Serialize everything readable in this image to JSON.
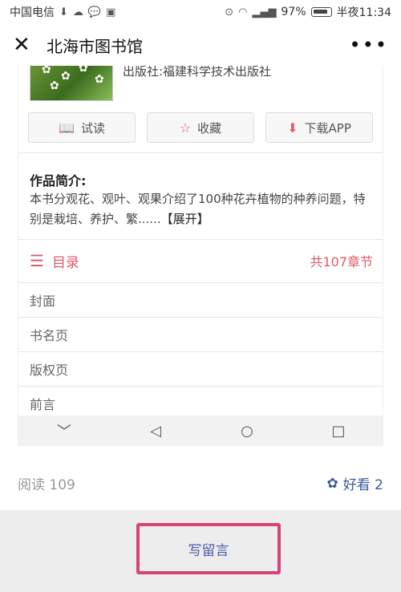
{
  "status_bar": {
    "carrier": "中国电信",
    "battery": "97%",
    "time": "半夜11:34"
  },
  "title_bar": {
    "title": "北海市图书馆"
  },
  "book": {
    "publisher": "出版社:福建科学技术出版社"
  },
  "buttons": {
    "trial": "试读",
    "favorite": "收藏",
    "download": "下载APP"
  },
  "intro": {
    "title": "作品简介:",
    "text": "本书分观花、观叶、观果介绍了100种花卉植物的种养问题，特别是栽培、养护、繁......",
    "expand": "【展开】"
  },
  "toc": {
    "title": "目录",
    "count": "共107章节",
    "items": [
      "封面",
      "书名页",
      "版权页",
      "前言"
    ]
  },
  "footer": {
    "read": "阅读 109",
    "likes": "好看 2",
    "comment": "写留言"
  }
}
